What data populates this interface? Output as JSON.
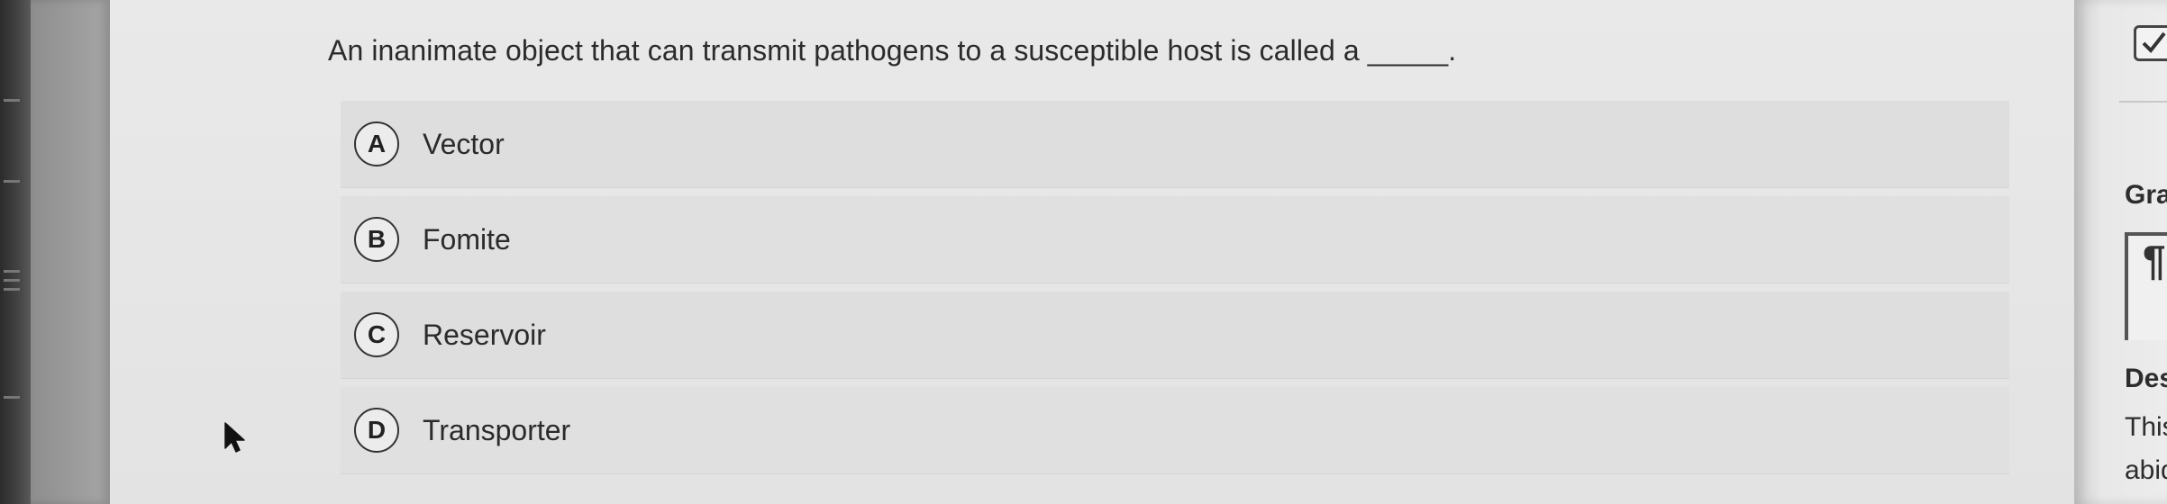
{
  "question": {
    "text": "An inanimate object that can transmit pathogens to a susceptible host is called a _____."
  },
  "options": [
    {
      "letter": "A",
      "text": "Vector"
    },
    {
      "letter": "B",
      "text": "Fomite"
    },
    {
      "letter": "C",
      "text": "Reservoir"
    },
    {
      "letter": "D",
      "text": "Transporter"
    }
  ],
  "sidebar": {
    "check_icon": "checkbox-checked-icon",
    "grade_label": "Gra",
    "format_icon": "paragraph-format-icon",
    "description_label": "Des",
    "description_line1": "This",
    "description_line2": "abid"
  },
  "colors": {
    "background": "#e4e4e4",
    "option_background": "#e0e0e0",
    "text": "#2b2b2b",
    "bezel": "#2b2b2b"
  }
}
